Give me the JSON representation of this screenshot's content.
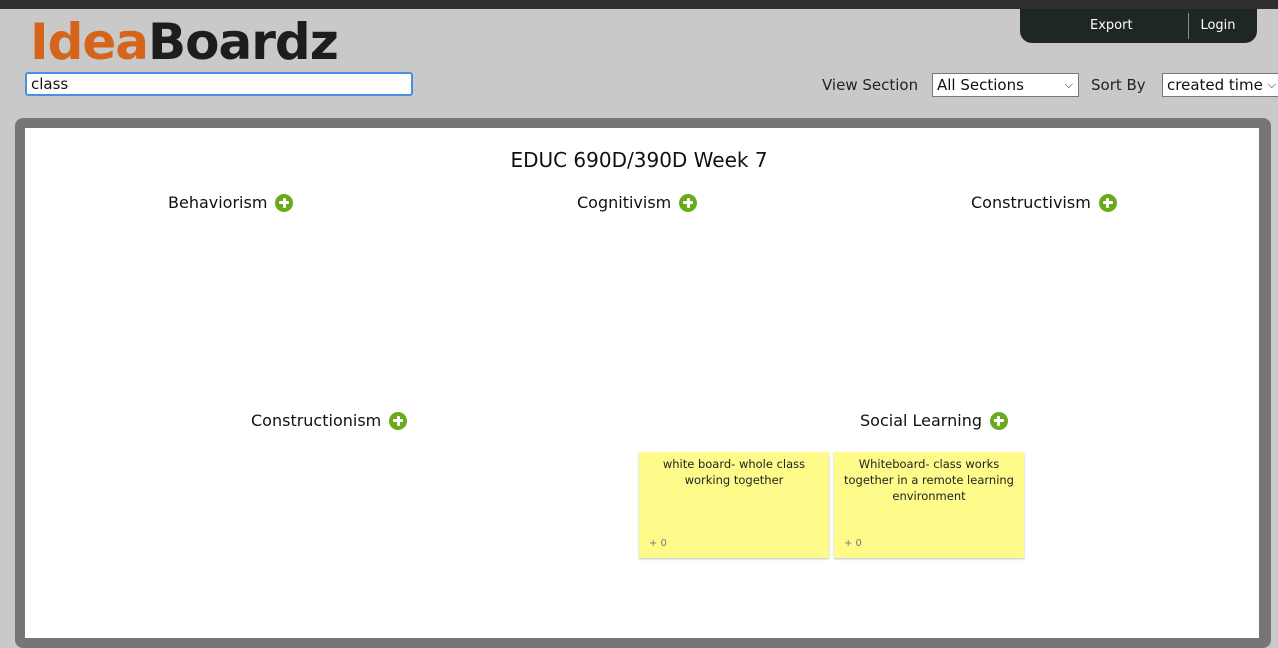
{
  "app": {
    "logo_part1": "Idea",
    "logo_part2": "Boardz"
  },
  "search": {
    "value": "class"
  },
  "nav": {
    "export": "Export",
    "login": "Login"
  },
  "controls": {
    "view_section_label": "View Section",
    "view_section_value": "All Sections",
    "sort_by_label": "Sort By",
    "sort_by_value": "created time"
  },
  "board": {
    "title": "EDUC 690D/390D Week 7",
    "sections": [
      {
        "name": "Behaviorism"
      },
      {
        "name": "Cognitivism"
      },
      {
        "name": "Constructivism"
      },
      {
        "name": "Constructionism"
      },
      {
        "name": "Social Learning"
      }
    ],
    "notes": [
      {
        "text": "white board- whole class working together",
        "votes": "+ 0"
      },
      {
        "text": "Whiteboard- class works together in a remote learning environment",
        "votes": "+ 0"
      }
    ]
  }
}
